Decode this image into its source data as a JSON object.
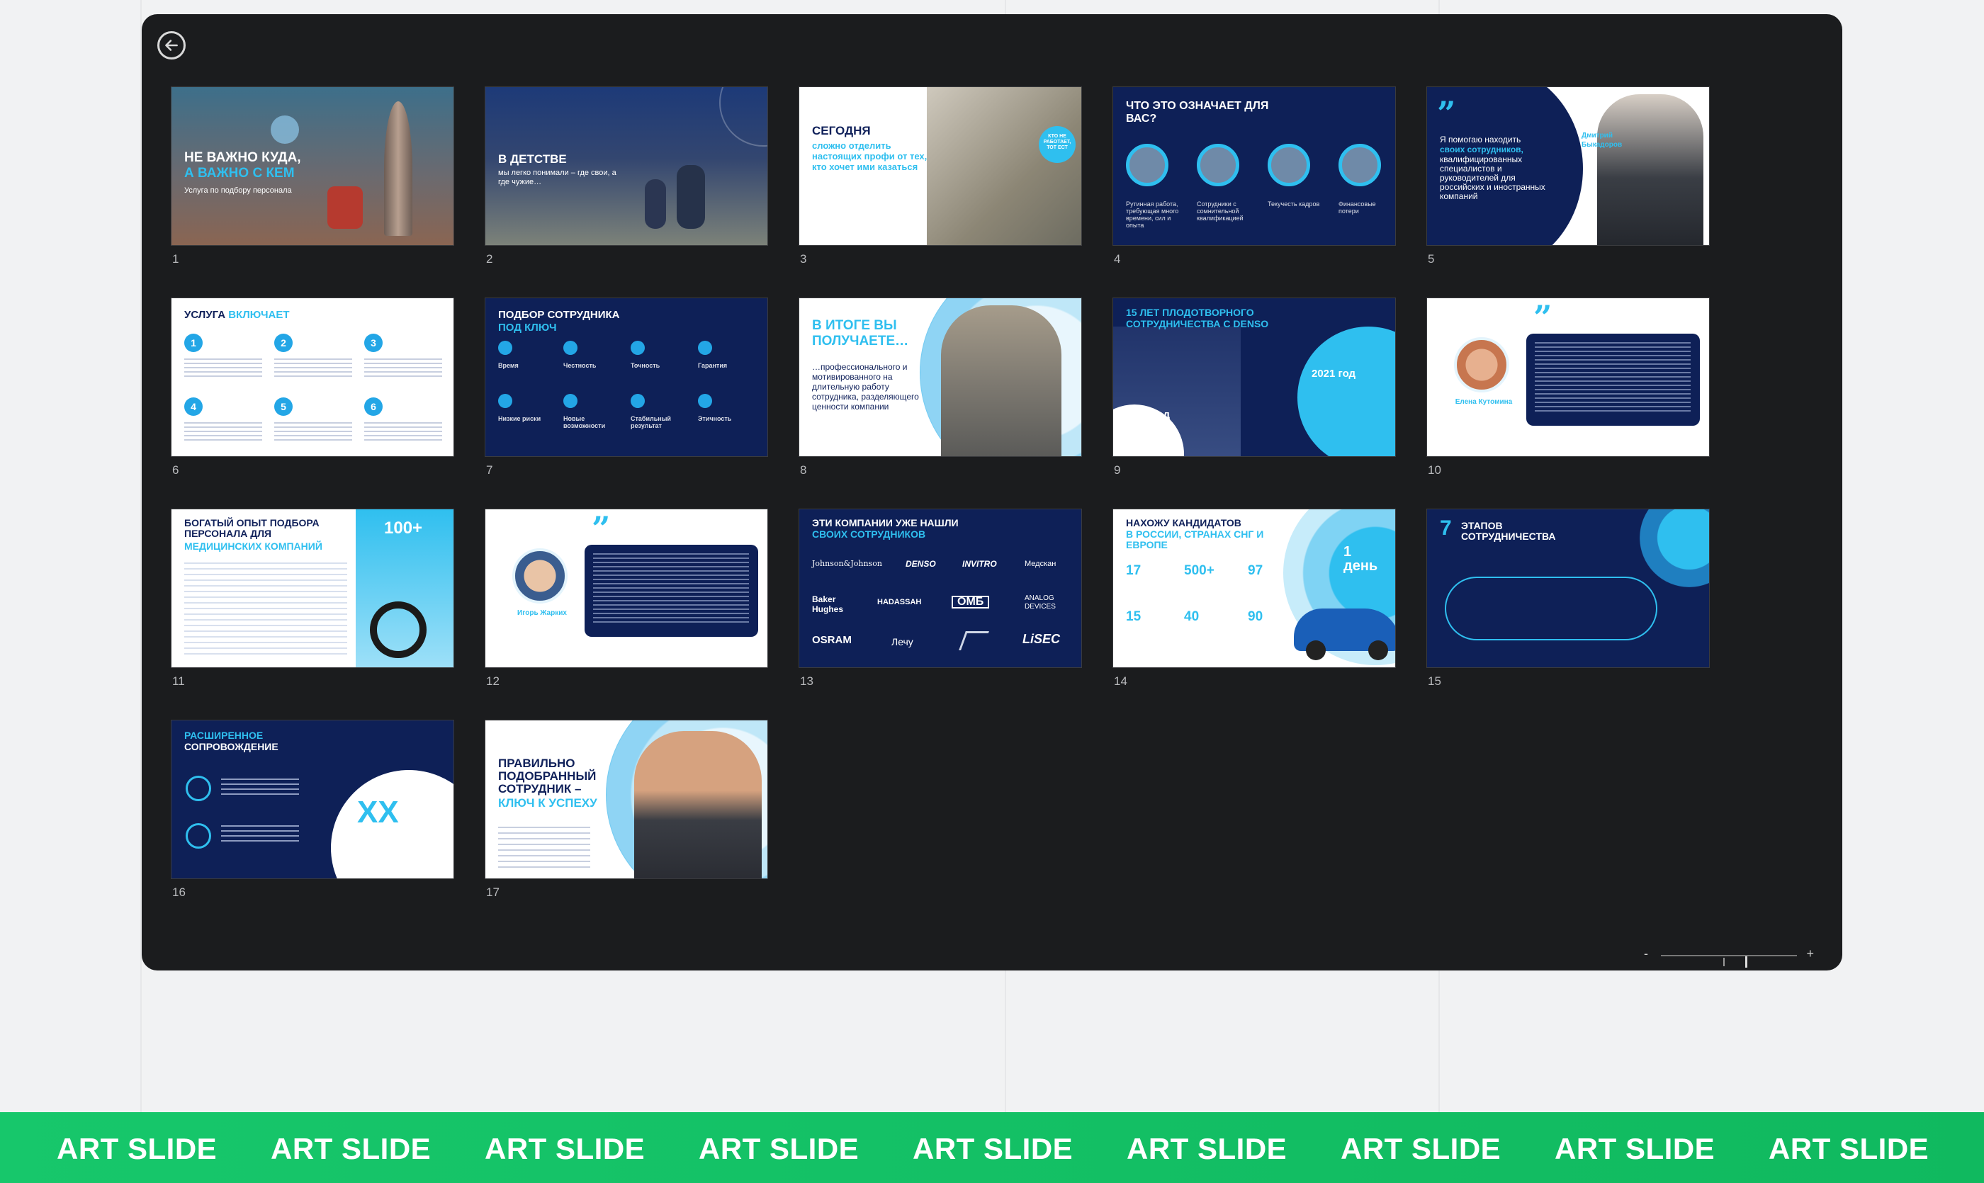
{
  "viewer": {
    "back_icon": "arrow-left-circle-icon",
    "zoom": {
      "minus": "-",
      "plus": "+"
    }
  },
  "slides": [
    {
      "n": "1",
      "title": "НЕ ВАЖНО КУДА,",
      "title2": "А ВАЖНО С КЕМ",
      "body": "Услуга по подбору персонала"
    },
    {
      "n": "2",
      "title": "В ДЕТСТВЕ",
      "body": "мы легко понимали – где свои, а где чужие…"
    },
    {
      "n": "3",
      "title": "СЕГОДНЯ",
      "title2": "сложно отделить настоящих профи от тех, кто хочет ими казаться",
      "badge": "КТО НЕ РАБОТАЕТ, ТОТ ЕСТ"
    },
    {
      "n": "4",
      "title": "ЧТО ЭТО ОЗНАЧАЕТ ДЛЯ ВАС?",
      "items": [
        "Рутинная работа, требующая много времени, сил и опыта",
        "Сотрудники с сомнительной квалификацией",
        "Текучесть кадров",
        "Финансовые потери"
      ]
    },
    {
      "n": "5",
      "title": "Я помогаю находить",
      "title2": "своих сотрудников,",
      "body": "квалифицированных специалистов и руководителей для российских и иностранных компаний",
      "name": "Дмитрий Быкадоров"
    },
    {
      "n": "6",
      "title": "УСЛУГА",
      "title2": "ВКЛЮЧАЕТ",
      "steps": [
        "1",
        "2",
        "3",
        "4",
        "5",
        "6"
      ]
    },
    {
      "n": "7",
      "title": "ПОДБОР СОТРУДНИКА",
      "title2": "ПОД КЛЮЧ",
      "items": [
        "Время",
        "Честность",
        "Точность",
        "Гарантия",
        "Низкие риски",
        "Новые возможности",
        "Стабильный результат",
        "Этичность"
      ]
    },
    {
      "n": "8",
      "title": "В ИТОГЕ ВЫ ПОЛУЧАЕТЕ…",
      "body": "…профессионального и мотивированного на длительную работу сотрудника, разделяющего ценности компании"
    },
    {
      "n": "9",
      "title": "15 ЛЕТ ПЛОДОТВОРНОГО СОТРУДНИЧЕСТВА С DENSO",
      "year1": "2006 год",
      "year2": "2021 год"
    },
    {
      "n": "10",
      "name": "Елена Кутомина"
    },
    {
      "n": "11",
      "title": "БОГАТЫЙ ОПЫТ ПОДБОРА ПЕРСОНАЛА ДЛЯ",
      "title2": "МЕДИЦИНСКИХ КОМПАНИЙ",
      "stat": "100+"
    },
    {
      "n": "12",
      "name": "Игорь Жарких"
    },
    {
      "n": "13",
      "title": "ЭТИ КОМПАНИИ УЖЕ НАШЛИ",
      "title2": "СВОИХ СОТРУДНИКОВ",
      "logos": [
        "Johnson&Johnson",
        "DENSO",
        "INVITRO",
        "Медскан",
        "Baker Hughes",
        "HADASSAH",
        "ОМБ",
        "ANALOG DEVICES",
        "OSRAM",
        "Лечу",
        "",
        "LiSEC"
      ]
    },
    {
      "n": "14",
      "title": "НАХОЖУ КАНДИДАТОВ",
      "title2": "В РОССИИ, СТРАНАХ СНГ И ЕВРОПЕ",
      "stats": [
        "17",
        "500+",
        "97",
        "15",
        "40",
        "90"
      ],
      "badge": "1 день"
    },
    {
      "n": "15",
      "title": "7",
      "title2": "ЭТАПОВ СОТРУДНИЧЕСТВА"
    },
    {
      "n": "16",
      "title": "РАСШИРЕННОЕ",
      "title2": "СОПРОВОЖДЕНИЕ",
      "stat": "XX"
    },
    {
      "n": "17",
      "title": "ПРАВИЛЬНО ПОДОБРАННЫЙ СОТРУДНИК –",
      "title2": "КЛЮЧ К УСПЕХУ"
    }
  ],
  "banner": {
    "label": "ART SLIDE",
    "count": 9
  },
  "colors": {
    "navy": "#0e2057",
    "accent": "#2fbfef",
    "banner": "#17c76b",
    "panel": "#1b1c1e"
  }
}
